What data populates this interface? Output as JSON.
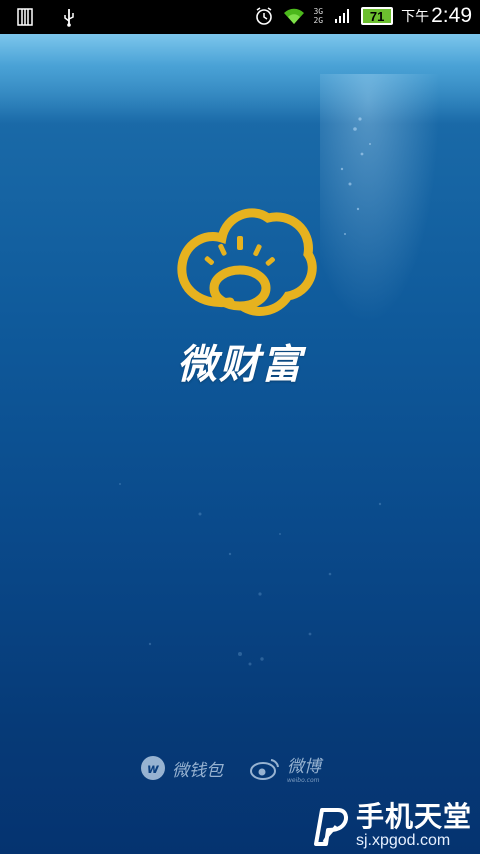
{
  "status_bar": {
    "network_labels": [
      "3G",
      "2G"
    ],
    "battery": "71",
    "period": "下午",
    "time": "2:49"
  },
  "splash": {
    "app_name": "微财富",
    "partners": [
      {
        "label": "微钱包",
        "icon": "wallet-logo-icon"
      },
      {
        "label": "微博",
        "sub": "weibo.com",
        "icon": "weibo-logo-icon"
      }
    ]
  },
  "watermark": {
    "title": "手机天堂",
    "url": "sj.xpgod.com"
  },
  "colors": {
    "logo_gold": "#e6b21f",
    "status_bar": "#000000",
    "battery": "#6cbf2f",
    "ocean_top": "#2c7fb8",
    "ocean_bottom": "#053370"
  }
}
